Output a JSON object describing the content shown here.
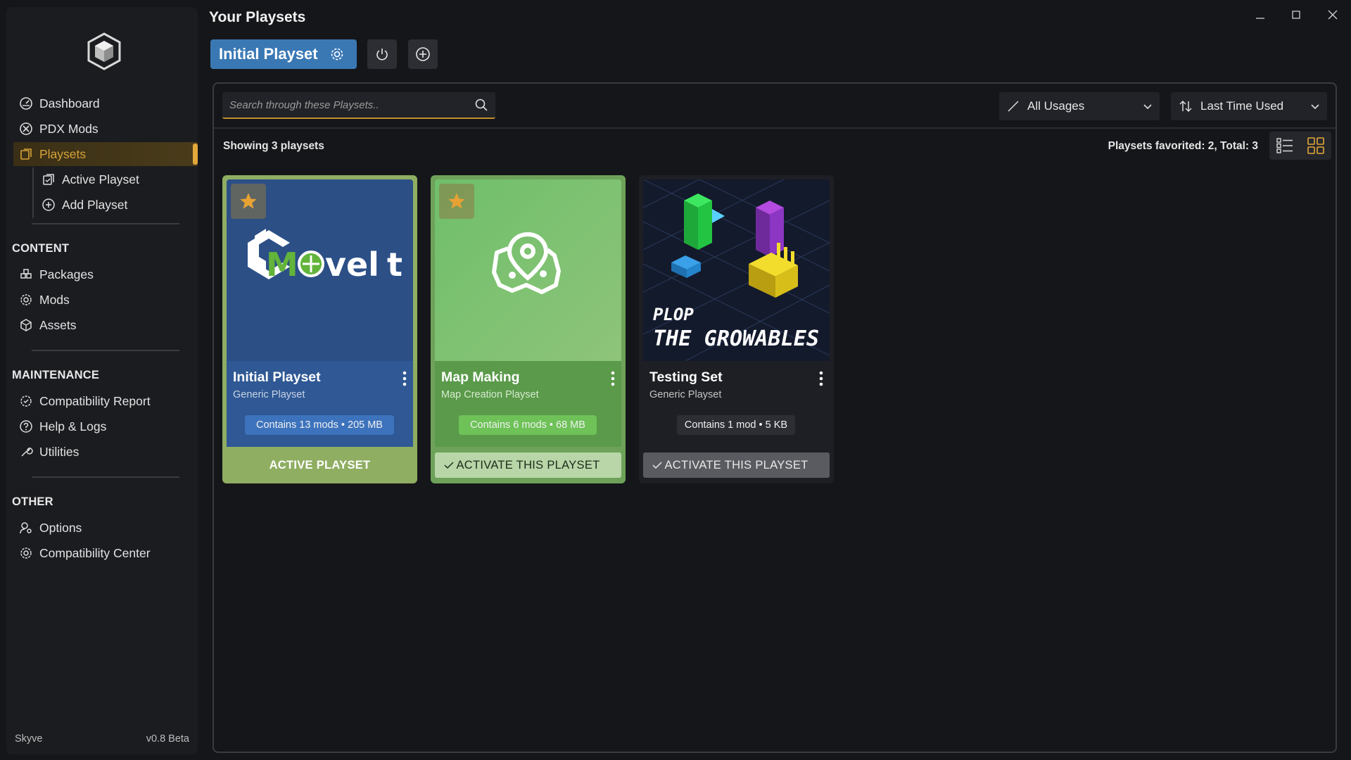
{
  "app": {
    "name": "Skyve",
    "version": "v0.8 Beta",
    "page_title": "Your Playsets",
    "accent_color": "#e3a73a",
    "primary_color": "#3a78b4"
  },
  "window_controls": {
    "minimize_icon": "minimize-icon",
    "maximize_icon": "maximize-icon",
    "close_icon": "close-icon"
  },
  "sidebar": {
    "top_items": [
      {
        "label": "Dashboard",
        "icon": "dashboard-icon"
      },
      {
        "label": "PDX Mods",
        "icon": "paradox-icon"
      },
      {
        "label": "Playsets",
        "icon": "playsets-icon",
        "active": true
      }
    ],
    "sub_items": [
      {
        "label": "Active Playset",
        "icon": "active-playset-icon"
      },
      {
        "label": "Add Playset",
        "icon": "add-circle-icon"
      }
    ],
    "sections": [
      {
        "title": "CONTENT",
        "items": [
          {
            "label": "Packages",
            "icon": "packages-icon"
          },
          {
            "label": "Mods",
            "icon": "mods-icon"
          },
          {
            "label": "Assets",
            "icon": "assets-icon"
          }
        ]
      },
      {
        "title": "MAINTENANCE",
        "items": [
          {
            "label": "Compatibility Report",
            "icon": "compatibility-report-icon"
          },
          {
            "label": "Help & Logs",
            "icon": "help-icon"
          },
          {
            "label": "Utilities",
            "icon": "wrench-icon"
          }
        ]
      },
      {
        "title": "OTHER",
        "items": [
          {
            "label": "Options",
            "icon": "options-icon"
          },
          {
            "label": "Compatibility Center",
            "icon": "compatibility-center-icon"
          }
        ]
      }
    ]
  },
  "header": {
    "current_playset": "Initial Playset"
  },
  "filters": {
    "search_placeholder": "Search through these Playsets..",
    "usage_filter": "All Usages",
    "sort": "Last Time Used"
  },
  "summary": {
    "showing": "Showing 3 playsets",
    "favorites": "Playsets favorited: 2, Total: 3"
  },
  "playsets": [
    {
      "name": "Initial Playset",
      "type": "Generic Playset",
      "contents": "Contains 13 mods • 205 MB",
      "action": "ACTIVE PLAYSET",
      "favorite": true,
      "active": true,
      "thumb_text_a": "M",
      "thumb_text_b": "vel",
      "thumb_text_c": "t",
      "color": "#2f5894"
    },
    {
      "name": "Map Making",
      "type": "Map Creation Playset",
      "contents": "Contains 6 mods • 68 MB",
      "action": "ACTIVATE THIS PLAYSET",
      "favorite": true,
      "active": false,
      "color": "#5aa85a"
    },
    {
      "name": "Testing Set",
      "type": "Generic Playset",
      "contents": "Contains 1 mod • 5 KB",
      "action": "ACTIVATE THIS PLAYSET",
      "favorite": false,
      "active": false,
      "thumb_title_1": "PLOP",
      "thumb_title_2": "THE GROWABLES",
      "color": "#1b1c22"
    }
  ]
}
